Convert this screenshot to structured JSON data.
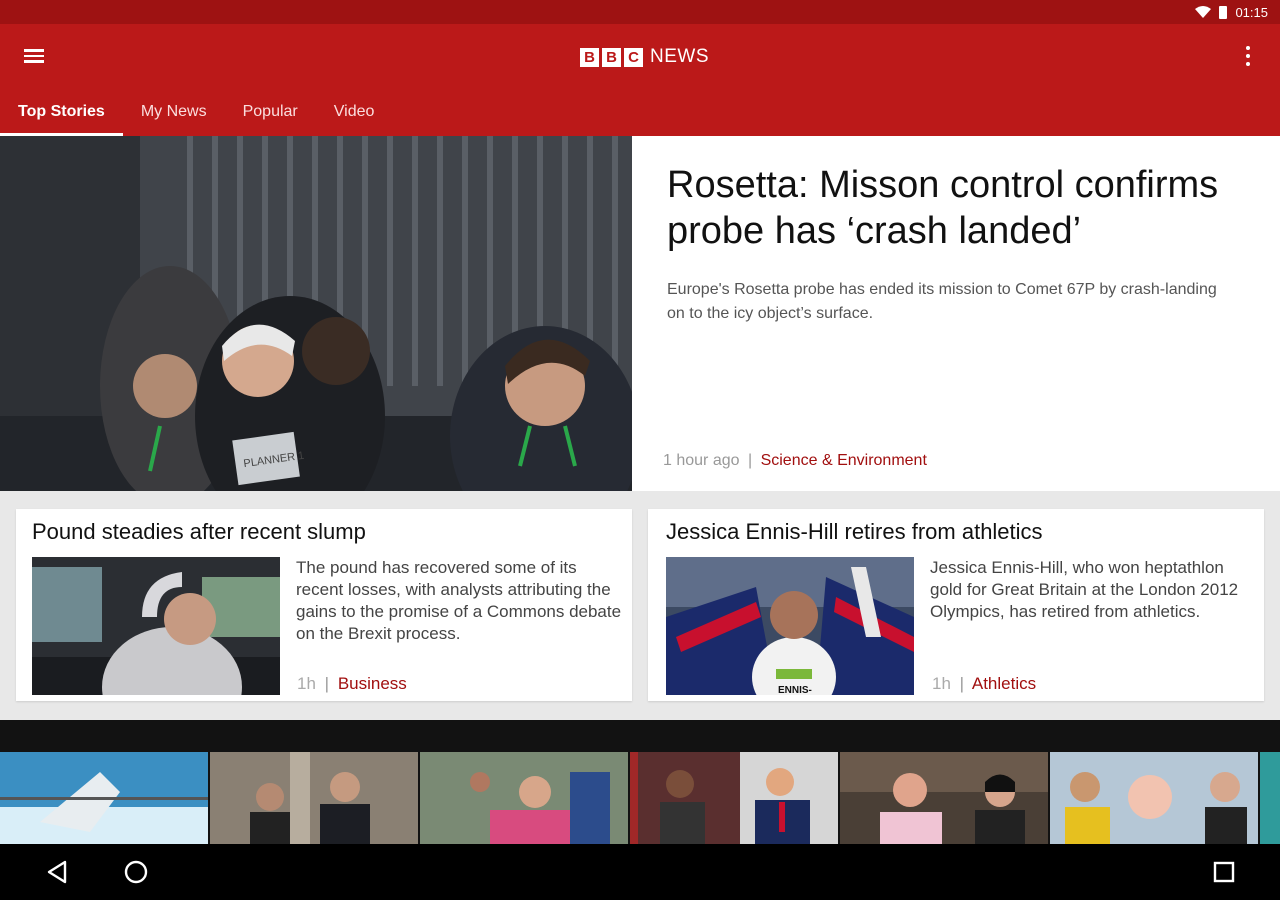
{
  "status_bar": {
    "time": "01:15"
  },
  "app_bar": {
    "logo_letters": [
      "B",
      "B",
      "C"
    ],
    "logo_word": "NEWS",
    "tabs": [
      {
        "label": "Top Stories",
        "active": true
      },
      {
        "label": "My News",
        "active": false
      },
      {
        "label": "Popular",
        "active": false
      },
      {
        "label": "Video",
        "active": false
      }
    ]
  },
  "hero": {
    "title": "Rosetta: Misson control confirms probe has ‘crash landed’",
    "summary": "Europe's Rosetta probe has ended its mission to Comet 67P by crash-landing on to the icy object’s surface.",
    "time": "1 hour ago",
    "separator": "|",
    "section": "Science & Environment",
    "image_text": "PLANNER 1"
  },
  "cards": [
    {
      "title": "Pound steadies after recent slump",
      "summary": "The pound has recovered some of its recent losses, with analysts attributing the gains to the promise of a Commons debate on the Brexit process.",
      "time": "1h",
      "separator": "|",
      "section": "Business"
    },
    {
      "title": "Jessica Ennis-Hill retires from athletics",
      "summary": "Jessica Ennis-Hill, who won heptathlon gold for Great Britain at the London 2012 Olympics, has retired from athletics.",
      "time": "1h",
      "separator": "|",
      "section": "Athletics",
      "image_text": "ENNIS-"
    }
  ],
  "colors": {
    "brand_red": "#bb1919",
    "status_red": "#9e1212",
    "section_red": "#a10f0f"
  },
  "video_strip": {
    "thumbnails": [
      "shark-video",
      "courtroom-video",
      "rally-video",
      "michelle-obama-video",
      "donald-trump-video",
      "interview-man-video",
      "interview-woman-video",
      "selfie-video"
    ]
  },
  "nav_icons": [
    "back-icon",
    "home-icon",
    "recents-icon"
  ]
}
